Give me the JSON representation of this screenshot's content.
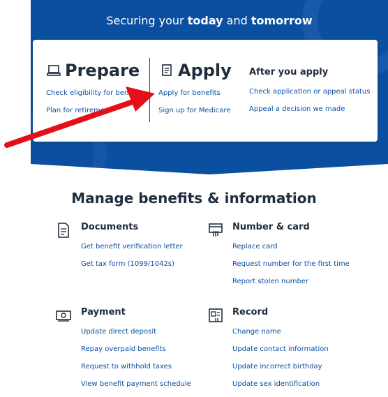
{
  "hero": {
    "headline_pre": "Securing your ",
    "headline_b1": "today",
    "headline_mid": " and ",
    "headline_b2": "tomorrow"
  },
  "prepare": {
    "title": "Prepare",
    "icon": "laptop-icon",
    "links": [
      "Check eligibility for benefits",
      "Plan for retirement"
    ]
  },
  "apply": {
    "title": "Apply",
    "icon": "form-icon",
    "links": [
      "Apply for benefits",
      "Sign up for Medicare"
    ]
  },
  "after": {
    "title": "After you apply",
    "links": [
      "Check application or appeal status",
      "Appeal a decision we made"
    ]
  },
  "manage": {
    "title": "Manage benefits & information",
    "sections": {
      "documents": {
        "title": "Documents",
        "icon": "document-icon",
        "links": [
          "Get benefit verification letter",
          "Get tax form (1099/1042s)"
        ]
      },
      "number_card": {
        "title": "Number & card",
        "icon": "card-hand-icon",
        "links": [
          "Replace card",
          "Request number for the first time",
          "Report stolen number"
        ]
      },
      "payment": {
        "title": "Payment",
        "icon": "money-icon",
        "links": [
          "Update direct deposit",
          "Repay overpaid benefits",
          "Request to withhold taxes",
          "View benefit payment schedule"
        ]
      },
      "record": {
        "title": "Record",
        "icon": "record-id-icon",
        "links": [
          "Change name",
          "Update contact information",
          "Update incorrect birthday",
          "Update sex identification"
        ]
      }
    }
  },
  "colors": {
    "hero_blue": "#0b4fa1",
    "link_blue": "#0b4fa1",
    "heading": "#1f2d3d",
    "arrow_red": "#e3101a"
  }
}
